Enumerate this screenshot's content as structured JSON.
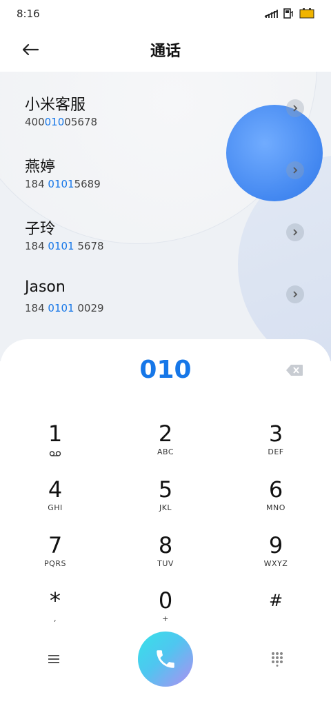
{
  "status_bar": {
    "time": "8:16"
  },
  "header": {
    "title": "通话"
  },
  "contacts": [
    {
      "name": "小米客服",
      "number_pre": "400",
      "number_hl": "010",
      "number_post": "05678"
    },
    {
      "name": "燕婷",
      "number_pre": "184 ",
      "number_hl": "0101",
      "number_post": "5689"
    },
    {
      "name": "子玲",
      "number_pre": "184 ",
      "number_hl": "0101",
      "number_post": " 5678"
    },
    {
      "name": "Jason",
      "number_pre": "184 ",
      "number_hl": "0101",
      "number_post": " 0029"
    }
  ],
  "dialpad": {
    "typed": "010",
    "keys": [
      {
        "digit": "1",
        "letters": ""
      },
      {
        "digit": "2",
        "letters": "ABC"
      },
      {
        "digit": "3",
        "letters": "DEF"
      },
      {
        "digit": "4",
        "letters": "GHI"
      },
      {
        "digit": "5",
        "letters": "JKL"
      },
      {
        "digit": "6",
        "letters": "MNO"
      },
      {
        "digit": "7",
        "letters": "PQRS"
      },
      {
        "digit": "8",
        "letters": "TUV"
      },
      {
        "digit": "9",
        "letters": "WXYZ"
      },
      {
        "digit": "*",
        "letters": ","
      },
      {
        "digit": "0",
        "letters": "+"
      },
      {
        "digit": "#",
        "letters": ""
      }
    ]
  },
  "icons": {
    "back": "arrow-left-icon",
    "delete": "backspace-icon",
    "voicemail": "voicemail-icon",
    "menu": "menu-icon",
    "call": "phone-icon",
    "keypad": "keypad-grid-icon"
  },
  "colors": {
    "accent": "#1677e8",
    "call_gradient_start": "#37e2e8",
    "call_gradient_end": "#b08ef2"
  }
}
